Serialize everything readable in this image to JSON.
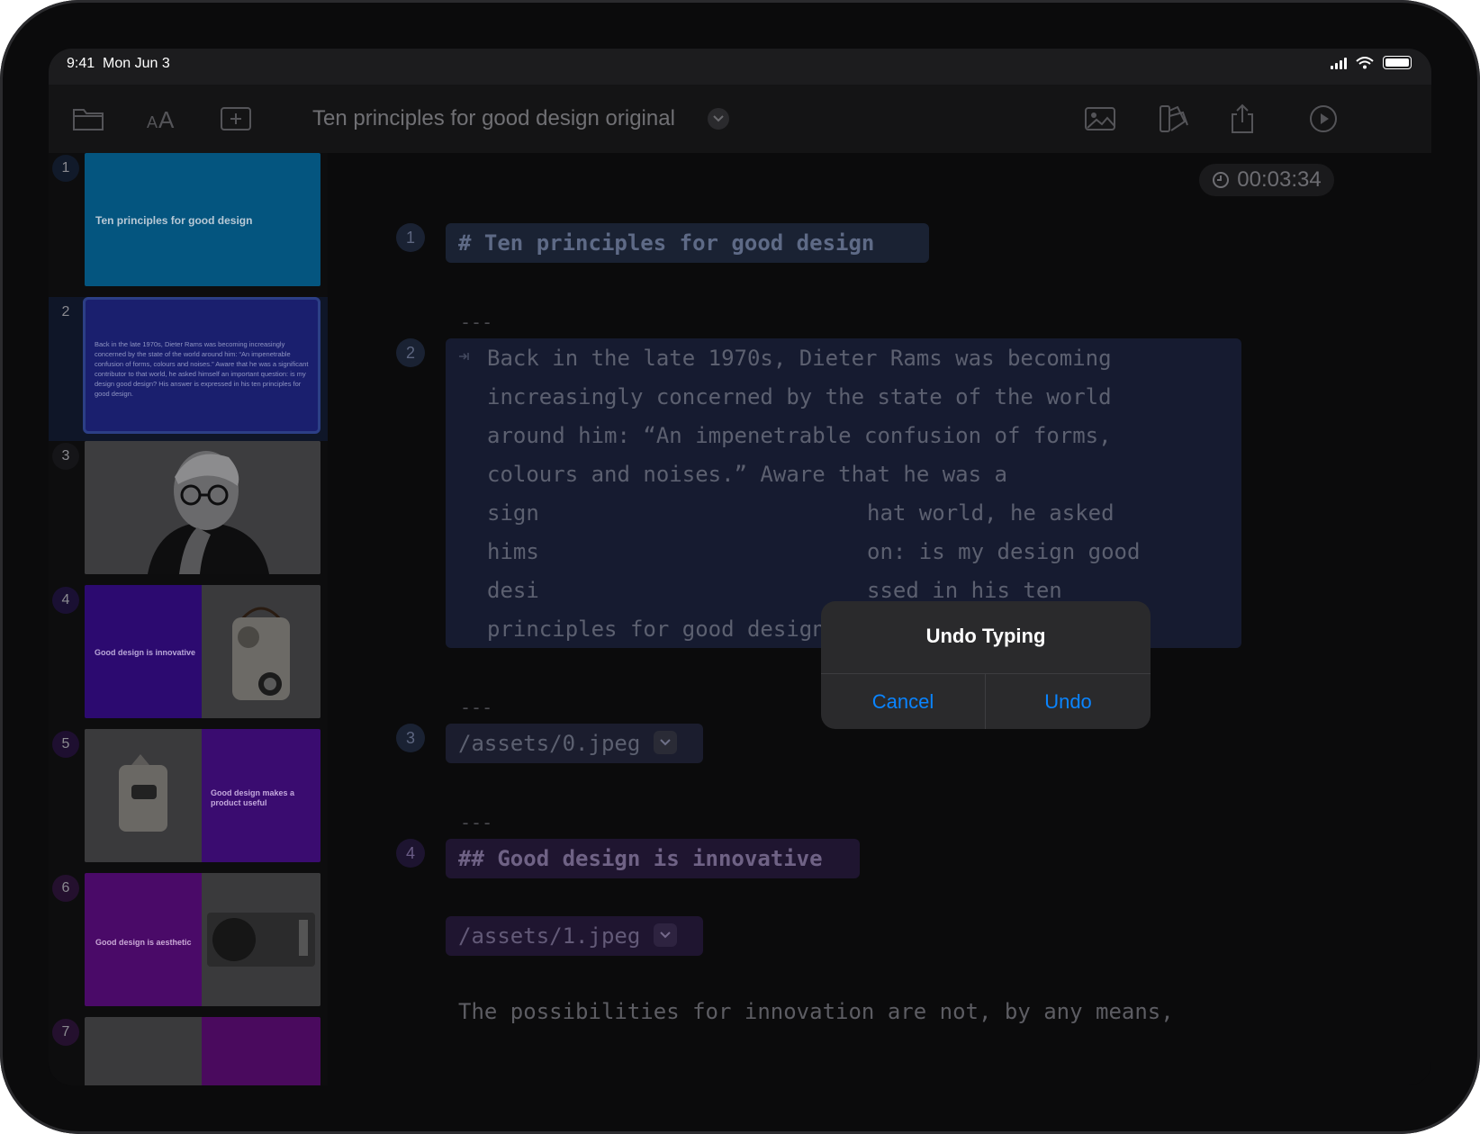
{
  "status": {
    "time": "9:41",
    "date": "Mon Jun 3"
  },
  "toolbar": {
    "title": "Ten principles for good design original",
    "icons": [
      "folder-icon",
      "text-size-icon",
      "add-slide-icon",
      "image-icon",
      "theme-icon",
      "share-icon",
      "play-icon"
    ]
  },
  "sidebar": {
    "slides": [
      {
        "num": "1",
        "text": "Ten principles for good design"
      },
      {
        "num": "2",
        "text": "Back in the late 1970s, Dieter Rams was becoming increasingly concerned by the state of the world around him: “An impenetrable confusion of forms, colours and noises.” Aware that he was a significant contributor to that world, he asked himself an important question: is my design good design? His answer is expressed in his ten principles for good design."
      },
      {
        "num": "3",
        "text": ""
      },
      {
        "num": "4",
        "text": "Good design is innovative"
      },
      {
        "num": "5",
        "text": "Good design makes a product useful"
      },
      {
        "num": "6",
        "text": "Good design is aesthetic"
      },
      {
        "num": "7",
        "text": ""
      }
    ]
  },
  "editor": {
    "timer": "00:03:34",
    "blocks": [
      {
        "num": "1",
        "heading": "# Ten principles for good design"
      },
      {
        "separator": "---"
      },
      {
        "num": "2",
        "lines": [
          "Back in the late 1970s, Dieter Rams was becoming",
          "increasingly concerned by the state of the world",
          "around him: “An impenetrable confusion of forms,",
          "colours and noises.” Aware that he was a",
          "sign",
          "hims",
          "desi",
          "principles for good design."
        ],
        "lines_right": [
          "hat world, he asked",
          "on: is my design good",
          "ssed in his ten"
        ]
      },
      {
        "separator": "---"
      },
      {
        "num": "3",
        "asset": "/assets/0.jpeg"
      },
      {
        "separator": "---"
      },
      {
        "num": "4",
        "heading": "## Good design is innovative",
        "asset": "/assets/1.jpeg",
        "body": "The possibilities for innovation are not, by any means,"
      }
    ]
  },
  "alert": {
    "title": "Undo Typing",
    "cancel": "Cancel",
    "confirm": "Undo"
  }
}
